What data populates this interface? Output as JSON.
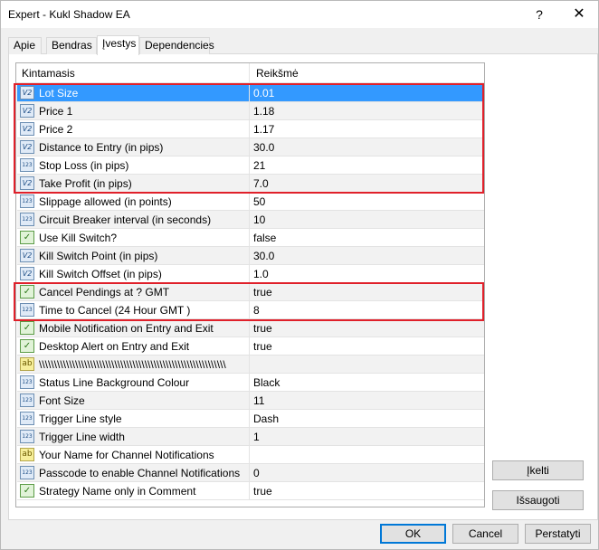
{
  "window": {
    "title": "Expert - Kukl Shadow EA",
    "help_glyph": "?",
    "close_glyph": "✕"
  },
  "tabs": [
    {
      "label": "Apie"
    },
    {
      "label": "Bendras"
    },
    {
      "label": "Įvestys"
    },
    {
      "label": "Dependencies"
    }
  ],
  "grid": {
    "col_name": "Kintamasis",
    "col_value": "Reikšmė",
    "rows": [
      {
        "icon": "double-icon",
        "glyph": "V2",
        "name": "Lot Size",
        "value": "0.01"
      },
      {
        "icon": "double-icon",
        "glyph": "V2",
        "name": "Price 1",
        "value": "1.18"
      },
      {
        "icon": "double-icon",
        "glyph": "V2",
        "name": "Price 2",
        "value": "1.17"
      },
      {
        "icon": "double-icon",
        "glyph": "V2",
        "name": "Distance to Entry (in pips)",
        "value": "30.0"
      },
      {
        "icon": "integer-icon",
        "glyph": "123",
        "name": "Stop Loss (in pips)",
        "value": "21"
      },
      {
        "icon": "double-icon",
        "glyph": "V2",
        "name": "Take Profit (in pips)",
        "value": "7.0"
      },
      {
        "icon": "integer-icon",
        "glyph": "123",
        "name": "Slippage allowed (in points)",
        "value": "50"
      },
      {
        "icon": "integer-icon",
        "glyph": "123",
        "name": "Circuit Breaker interval (in seconds)",
        "value": "10"
      },
      {
        "icon": "bool-icon",
        "glyph": "✓",
        "name": "Use Kill Switch?",
        "value": "false"
      },
      {
        "icon": "double-icon",
        "glyph": "V2",
        "name": "Kill Switch Point (in pips)",
        "value": "30.0"
      },
      {
        "icon": "double-icon",
        "glyph": "V2",
        "name": "Kill Switch Offset (in pips)",
        "value": "1.0"
      },
      {
        "icon": "bool-icon",
        "glyph": "✓",
        "name": "Cancel Pendings at ? GMT",
        "value": "true"
      },
      {
        "icon": "integer-icon",
        "glyph": "123",
        "name": "Time to Cancel (24 Hour GMT )",
        "value": "8"
      },
      {
        "icon": "bool-icon",
        "glyph": "✓",
        "name": "Mobile Notification on Entry and Exit",
        "value": "true"
      },
      {
        "icon": "bool-icon",
        "glyph": "✓",
        "name": "Desktop Alert on Entry and Exit",
        "value": "true"
      },
      {
        "icon": "string-icon",
        "glyph": "ab",
        "name": "\\\\\\\\\\\\\\\\\\\\\\\\\\\\\\\\\\\\\\\\\\\\\\\\\\\\\\\\\\\\\\\\\\\\\\\\\\\\\\\\\\\\\\\\\\\\\\\\\\\\\\\\\\\\\\\\\\\\\\\\\\\\",
        "value": ""
      },
      {
        "icon": "integer-icon",
        "glyph": "123",
        "name": "Status Line Background Colour",
        "value": "Black"
      },
      {
        "icon": "integer-icon",
        "glyph": "123",
        "name": "Font Size",
        "value": "11"
      },
      {
        "icon": "integer-icon",
        "glyph": "123",
        "name": "Trigger Line style",
        "value": "Dash"
      },
      {
        "icon": "integer-icon",
        "glyph": "123",
        "name": "Trigger Line width",
        "value": "1"
      },
      {
        "icon": "string-icon",
        "glyph": "ab",
        "name": "Your Name for Channel Notifications",
        "value": ""
      },
      {
        "icon": "integer-icon",
        "glyph": "123",
        "name": "Passcode to enable Channel Notifications",
        "value": "0"
      },
      {
        "icon": "bool-icon",
        "glyph": "✓",
        "name": "Strategy Name only in Comment",
        "value": "true"
      }
    ]
  },
  "side_buttons": {
    "load": "Įkelti",
    "save": "Išsaugoti"
  },
  "footer_buttons": {
    "ok": "OK",
    "cancel": "Cancel",
    "reset": "Perstatyti"
  },
  "colors": {
    "selection": "#3399ff",
    "highlight_border": "#e0202a"
  }
}
